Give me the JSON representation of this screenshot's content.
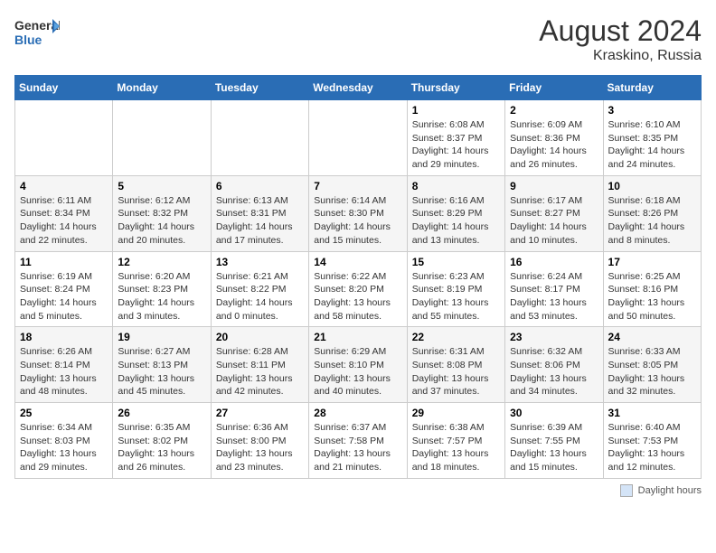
{
  "header": {
    "logo_general": "General",
    "logo_blue": "Blue",
    "month_year": "August 2024",
    "location": "Kraskino, Russia"
  },
  "weekdays": [
    "Sunday",
    "Monday",
    "Tuesday",
    "Wednesday",
    "Thursday",
    "Friday",
    "Saturday"
  ],
  "weeks": [
    [
      {
        "day": "",
        "info": ""
      },
      {
        "day": "",
        "info": ""
      },
      {
        "day": "",
        "info": ""
      },
      {
        "day": "",
        "info": ""
      },
      {
        "day": "1",
        "info": "Sunrise: 6:08 AM\nSunset: 8:37 PM\nDaylight: 14 hours\nand 29 minutes."
      },
      {
        "day": "2",
        "info": "Sunrise: 6:09 AM\nSunset: 8:36 PM\nDaylight: 14 hours\nand 26 minutes."
      },
      {
        "day": "3",
        "info": "Sunrise: 6:10 AM\nSunset: 8:35 PM\nDaylight: 14 hours\nand 24 minutes."
      }
    ],
    [
      {
        "day": "4",
        "info": "Sunrise: 6:11 AM\nSunset: 8:34 PM\nDaylight: 14 hours\nand 22 minutes."
      },
      {
        "day": "5",
        "info": "Sunrise: 6:12 AM\nSunset: 8:32 PM\nDaylight: 14 hours\nand 20 minutes."
      },
      {
        "day": "6",
        "info": "Sunrise: 6:13 AM\nSunset: 8:31 PM\nDaylight: 14 hours\nand 17 minutes."
      },
      {
        "day": "7",
        "info": "Sunrise: 6:14 AM\nSunset: 8:30 PM\nDaylight: 14 hours\nand 15 minutes."
      },
      {
        "day": "8",
        "info": "Sunrise: 6:16 AM\nSunset: 8:29 PM\nDaylight: 14 hours\nand 13 minutes."
      },
      {
        "day": "9",
        "info": "Sunrise: 6:17 AM\nSunset: 8:27 PM\nDaylight: 14 hours\nand 10 minutes."
      },
      {
        "day": "10",
        "info": "Sunrise: 6:18 AM\nSunset: 8:26 PM\nDaylight: 14 hours\nand 8 minutes."
      }
    ],
    [
      {
        "day": "11",
        "info": "Sunrise: 6:19 AM\nSunset: 8:24 PM\nDaylight: 14 hours\nand 5 minutes."
      },
      {
        "day": "12",
        "info": "Sunrise: 6:20 AM\nSunset: 8:23 PM\nDaylight: 14 hours\nand 3 minutes."
      },
      {
        "day": "13",
        "info": "Sunrise: 6:21 AM\nSunset: 8:22 PM\nDaylight: 14 hours\nand 0 minutes."
      },
      {
        "day": "14",
        "info": "Sunrise: 6:22 AM\nSunset: 8:20 PM\nDaylight: 13 hours\nand 58 minutes."
      },
      {
        "day": "15",
        "info": "Sunrise: 6:23 AM\nSunset: 8:19 PM\nDaylight: 13 hours\nand 55 minutes."
      },
      {
        "day": "16",
        "info": "Sunrise: 6:24 AM\nSunset: 8:17 PM\nDaylight: 13 hours\nand 53 minutes."
      },
      {
        "day": "17",
        "info": "Sunrise: 6:25 AM\nSunset: 8:16 PM\nDaylight: 13 hours\nand 50 minutes."
      }
    ],
    [
      {
        "day": "18",
        "info": "Sunrise: 6:26 AM\nSunset: 8:14 PM\nDaylight: 13 hours\nand 48 minutes."
      },
      {
        "day": "19",
        "info": "Sunrise: 6:27 AM\nSunset: 8:13 PM\nDaylight: 13 hours\nand 45 minutes."
      },
      {
        "day": "20",
        "info": "Sunrise: 6:28 AM\nSunset: 8:11 PM\nDaylight: 13 hours\nand 42 minutes."
      },
      {
        "day": "21",
        "info": "Sunrise: 6:29 AM\nSunset: 8:10 PM\nDaylight: 13 hours\nand 40 minutes."
      },
      {
        "day": "22",
        "info": "Sunrise: 6:31 AM\nSunset: 8:08 PM\nDaylight: 13 hours\nand 37 minutes."
      },
      {
        "day": "23",
        "info": "Sunrise: 6:32 AM\nSunset: 8:06 PM\nDaylight: 13 hours\nand 34 minutes."
      },
      {
        "day": "24",
        "info": "Sunrise: 6:33 AM\nSunset: 8:05 PM\nDaylight: 13 hours\nand 32 minutes."
      }
    ],
    [
      {
        "day": "25",
        "info": "Sunrise: 6:34 AM\nSunset: 8:03 PM\nDaylight: 13 hours\nand 29 minutes."
      },
      {
        "day": "26",
        "info": "Sunrise: 6:35 AM\nSunset: 8:02 PM\nDaylight: 13 hours\nand 26 minutes."
      },
      {
        "day": "27",
        "info": "Sunrise: 6:36 AM\nSunset: 8:00 PM\nDaylight: 13 hours\nand 23 minutes."
      },
      {
        "day": "28",
        "info": "Sunrise: 6:37 AM\nSunset: 7:58 PM\nDaylight: 13 hours\nand 21 minutes."
      },
      {
        "day": "29",
        "info": "Sunrise: 6:38 AM\nSunset: 7:57 PM\nDaylight: 13 hours\nand 18 minutes."
      },
      {
        "day": "30",
        "info": "Sunrise: 6:39 AM\nSunset: 7:55 PM\nDaylight: 13 hours\nand 15 minutes."
      },
      {
        "day": "31",
        "info": "Sunrise: 6:40 AM\nSunset: 7:53 PM\nDaylight: 13 hours\nand 12 minutes."
      }
    ]
  ],
  "footer": {
    "legend_label": "Daylight hours"
  }
}
